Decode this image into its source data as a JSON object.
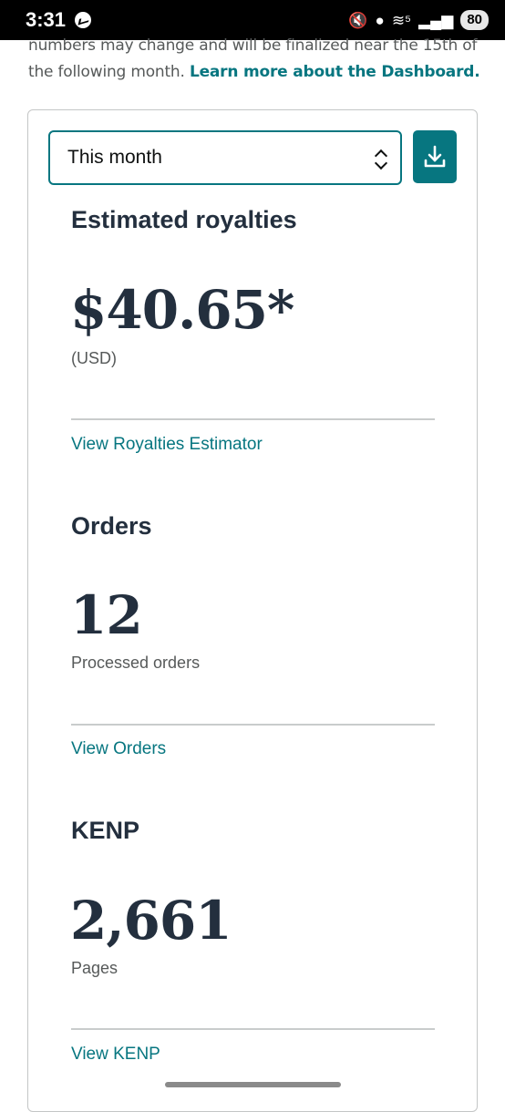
{
  "status_bar": {
    "time": "3:31",
    "battery": "80",
    "mute_glyph": "🔇",
    "location_glyph": "●",
    "wifi_glyph": "≋⁵",
    "signal_glyph": "▂▄▆"
  },
  "intro": {
    "text": "numbers may change and will be finalized near the 15th of the following month.",
    "link": "Learn more about the Dashboard."
  },
  "filter": {
    "selected": "This month"
  },
  "royalties": {
    "title": "Estimated royalties",
    "value": "$40.65*",
    "currency": "(USD)",
    "link": "View Royalties Estimator"
  },
  "orders": {
    "title": "Orders",
    "value": "12",
    "label": "Processed orders",
    "link": "View Orders"
  },
  "kenp": {
    "title": "KENP",
    "value": "2,661",
    "label": "Pages",
    "link": "View KENP"
  },
  "colors": {
    "accent": "#077680",
    "text_dark": "#232f3e",
    "text_muted": "#565959"
  }
}
